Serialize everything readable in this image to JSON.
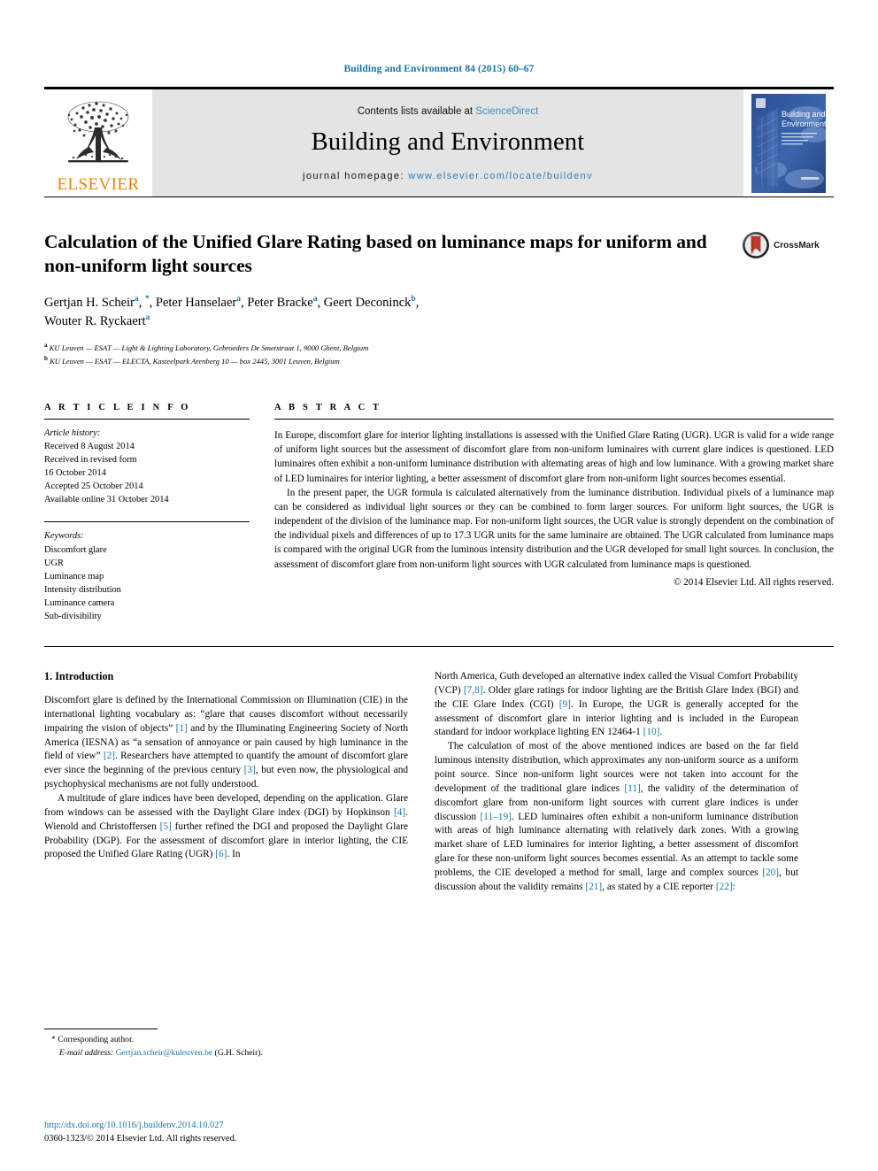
{
  "running_head": "Building and Environment 84 (2015) 60–67",
  "masthead": {
    "publisher": "ELSEVIER",
    "contents_prefix": "Contents lists available at ",
    "contents_link": "ScienceDirect",
    "journal_title": "Building and Environment",
    "homepage_prefix": "journal homepage: ",
    "homepage_url": "www.elsevier.com/locate/buildenv",
    "cover_title_line1": "Building and",
    "cover_title_line2": "Environment"
  },
  "crossmark": {
    "label": "CrossMark"
  },
  "article": {
    "title": "Calculation of the Unified Glare Rating based on luminance maps for uniform and non-uniform light sources",
    "authors_line1_pre": "Gertjan H. Scheir ",
    "authors": "Gertjan H. Scheir a, *, Peter Hanselaer a, Peter Bracke a, Geert Deconinck b, Wouter R. Ryckaert a",
    "affiliation_a": "KU Leuven — ESAT — Light & Lighting Laboratory, Gebroeders De Smetstraat 1, 9000 Ghent, Belgium",
    "affiliation_b": "KU Leuven — ESAT — ELECTA, Kasteelpark Arenberg 10 — box 2445, 3001 Leuven, Belgium",
    "affiliation_a_marker": "a",
    "affiliation_b_marker": "b"
  },
  "article_info": {
    "heading": "A R T I C L E   I N F O",
    "history_label": "Article history:",
    "history": [
      "Received 8 August 2014",
      "Received in revised form",
      "16 October 2014",
      "Accepted 25 October 2014",
      "Available online 31 October 2014"
    ],
    "keywords_label": "Keywords:",
    "keywords": [
      "Discomfort glare",
      "UGR",
      "Luminance map",
      "Intensity distribution",
      "Luminance camera",
      "Sub-divisibility"
    ]
  },
  "abstract": {
    "heading": "A B S T R A C T",
    "paragraph1": "In Europe, discomfort glare for interior lighting installations is assessed with the Unified Glare Rating (UGR). UGR is valid for a wide range of uniform light sources but the assessment of discomfort glare from non-uniform luminaires with current glare indices is questioned. LED luminaires often exhibit a non-uniform luminance distribution with alternating areas of high and low luminance. With a growing market share of LED luminaires for interior lighting, a better assessment of discomfort glare from non-uniform light sources becomes essential.",
    "paragraph2": "In the present paper, the UGR formula is calculated alternatively from the luminance distribution. Individual pixels of a luminance map can be considered as individual light sources or they can be combined to form larger sources. For uniform light sources, the UGR is independent of the division of the luminance map. For non-uniform light sources, the UGR value is strongly dependent on the combination of the individual pixels and differences of up to 17.3 UGR units for the same luminaire are obtained. The UGR calculated from luminance maps is compared with the original UGR from the luminous intensity distribution and the UGR developed for small light sources. In conclusion, the assessment of discomfort glare from non-uniform light sources with UGR calculated from luminance maps is questioned.",
    "copyright": "© 2014 Elsevier Ltd. All rights reserved."
  },
  "introduction": {
    "heading": "1. Introduction",
    "left_p1_a": "Discomfort glare is defined by the International Commission on Illumination (CIE) in the international lighting vocabulary as: “glare that causes discomfort without necessarily impairing the vision of objects” ",
    "left_p1_c1": "[1]",
    "left_p1_b": " and by the Illuminating Engineering Society of North America (IESNA) as “a sensation of annoyance or pain caused by high luminance in the field of view” ",
    "left_p1_c2": "[2]",
    "left_p1_c": ". Researchers have attempted to quantify the amount of discomfort glare ever since the beginning of the previous century ",
    "left_p1_c3": "[3]",
    "left_p1_d": ", but even now, the physiological and psychophysical mechanisms are not fully understood.",
    "left_p2_a": "A multitude of glare indices have been developed, depending on the application. Glare from windows can be assessed with the Daylight Glare index (DGI) by Hopkinson ",
    "left_p2_c1": "[4]",
    "left_p2_b": ". Wienold and Christoffersen ",
    "left_p2_c2": "[5]",
    "left_p2_c": " further refined the DGI and proposed the Daylight Glare Probability (DGP). For the assessment of discomfort glare in interior lighting, the CIE proposed the Unified Glare Rating (UGR) ",
    "left_p2_c3": "[6]",
    "left_p2_d": ". In",
    "right_p1_a": "North America, Guth developed an alternative index called the Visual Comfort Probability (VCP) ",
    "right_p1_c1": "[7,8]",
    "right_p1_b": ". Older glare ratings for indoor lighting are the British Glare Index (BGI) and the CIE Glare Index (CGI) ",
    "right_p1_c2": "[9]",
    "right_p1_c": ". In Europe, the UGR is generally accepted for the assessment of discomfort glare in interior lighting and is included in the European standard for indoor workplace lighting EN 12464-1 ",
    "right_p1_c3": "[10]",
    "right_p1_d": ".",
    "right_p2_a": "The calculation of most of the above mentioned indices are based on the far field luminous intensity distribution, which approximates any non-uniform source as a uniform point source. Since non-uniform light sources were not taken into account for the development of the traditional glare indices ",
    "right_p2_c1": "[11]",
    "right_p2_b": ", the validity of the determination of discomfort glare from non-uniform light sources with current glare indices is under discussion ",
    "right_p2_c2": "[11–19]",
    "right_p2_c": ". LED luminaires often exhibit a non-uniform luminance distribution with areas of high luminance alternating with relatively dark zones. With a growing market share of LED luminaires for interior lighting, a better assessment of discomfort glare for these non-uniform light sources becomes essential. As an attempt to tackle some problems, the CIE developed a method for small, large and complex sources ",
    "right_p2_c3": "[20]",
    "right_p2_d": ", but discussion about the validity remains ",
    "right_p2_c4": "[21]",
    "right_p2_e": ", as stated by a CIE reporter ",
    "right_p2_c5": "[22]",
    "right_p2_f": ":"
  },
  "footnote": {
    "marker": "*",
    "corresponding": "Corresponding author.",
    "email_label": "E-mail address:",
    "email": "Gertjan.scheir@kuleuven.be",
    "email_suffix": " (G.H. Scheir)."
  },
  "page_footer": {
    "doi": "http://dx.doi.org/10.1016/j.buildenv.2014.10.027",
    "issn_line": "0360-1323/© 2014 Elsevier Ltd. All rights reserved."
  },
  "colors": {
    "link_blue": "#1a75a7",
    "science_direct_blue": "#3a8dc4",
    "elsevier_orange": "#f08000",
    "band_gray": "#e4e4e4"
  }
}
